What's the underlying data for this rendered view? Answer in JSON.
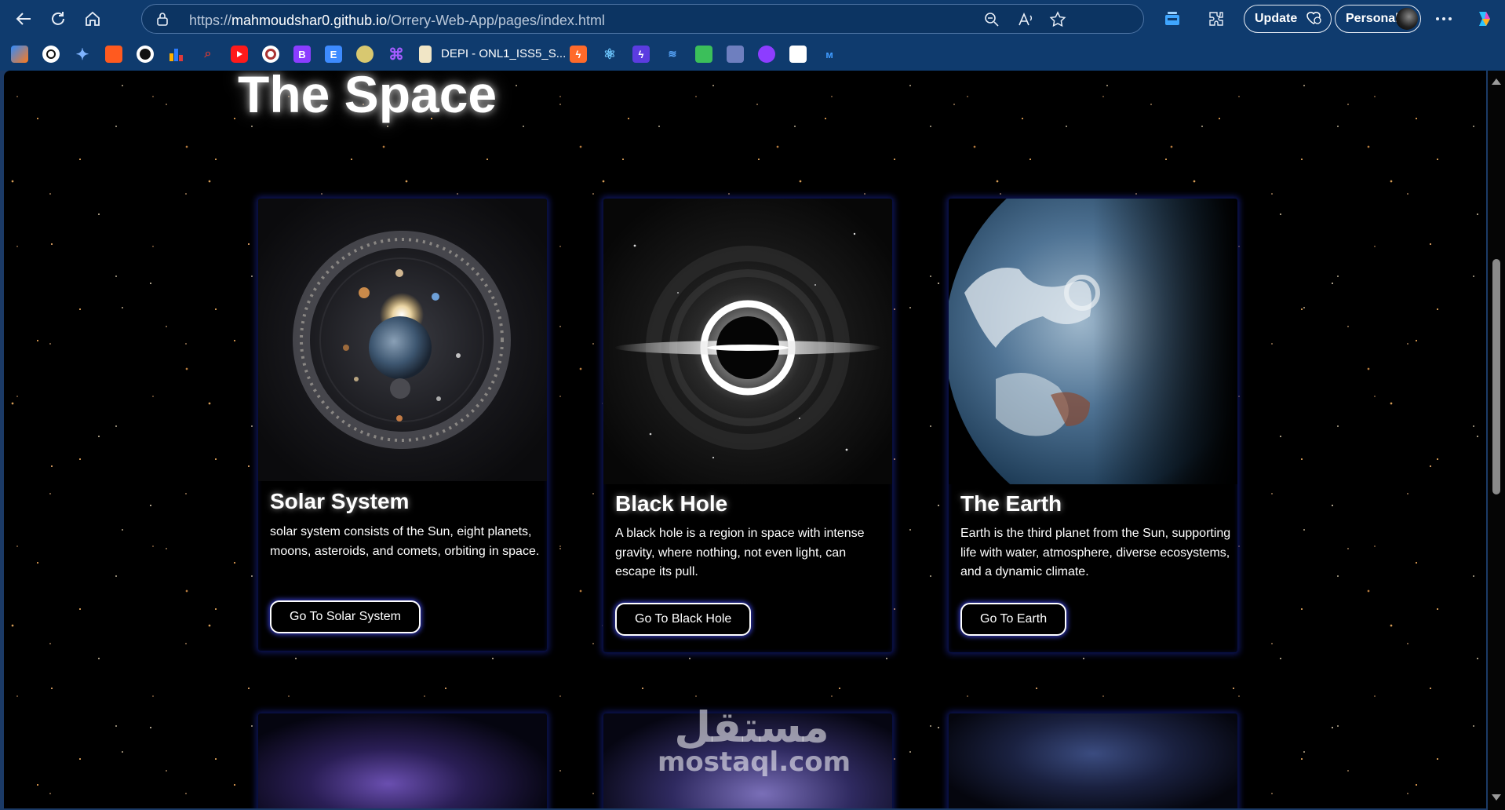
{
  "browser": {
    "url_prefix": "https://",
    "url_host": "mahmoudshar0.github.io",
    "url_path": "/Orrery-Web-App/pages/index.html",
    "update_label": "Update",
    "profile_label": "Personal",
    "bookmark_label": "DEPI - ONL1_ISS5_S...",
    "bookmark_letters": {
      "b": "B",
      "e": "E"
    }
  },
  "page": {
    "title": "The Space",
    "cards": [
      {
        "title": "Solar System",
        "description": "solar system consists of the Sun, eight planets, moons, asteroids, and comets, orbiting in space.",
        "button": "Go To Solar System"
      },
      {
        "title": "Black Hole",
        "description": "A black hole is a region in space with intense gravity, where nothing, not even light, can escape its pull.",
        "button": "Go To Black Hole"
      },
      {
        "title": "The Earth",
        "description": "Earth is the third planet from the Sun, supporting life with water, atmosphere, diverse ecosystems, and a dynamic climate.",
        "button": "Go To Earth"
      }
    ]
  },
  "watermark": {
    "arabic": "مستقل",
    "latin": "mostaql.com"
  },
  "colors": {
    "chrome": "#0f3b6e",
    "page_bg": "#000000",
    "card_glow": "#1e28aa",
    "button_glow": "#3c46e6"
  },
  "icons": [
    "back-icon",
    "refresh-icon",
    "home-icon",
    "lock-icon",
    "zoom-icon",
    "read-aloud-icon",
    "favorite-icon",
    "collections-icon",
    "extensions-icon",
    "more-icon",
    "copilot-icon"
  ]
}
